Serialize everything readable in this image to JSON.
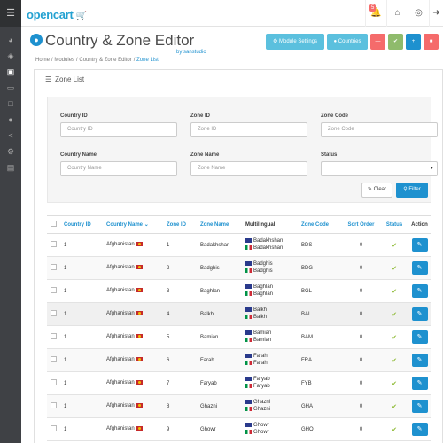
{
  "topbar": {
    "logo": "opencart",
    "logo_cart_icon": "cart-icon",
    "notification_count": "5"
  },
  "header": {
    "title": "Country & Zone Editor",
    "byline": "by sanstudio",
    "buttons": {
      "module_settings": "Module Settings",
      "countries": "Countries"
    },
    "colors": {
      "blue": "#5bc0de",
      "red": "#f56b6b",
      "green": "#8fbb6c",
      "primary": "#1e91cf"
    }
  },
  "breadcrumb": [
    "Home",
    "Modules",
    "Country & Zone Editor",
    "Zone List"
  ],
  "panel": {
    "heading": "Zone List"
  },
  "filter": {
    "country_id_label": "Country ID",
    "country_id_placeholder": "Country ID",
    "zone_id_label": "Zone ID",
    "zone_id_placeholder": "Zone ID",
    "zone_code_label": "Zone Code",
    "zone_code_placeholder": "Zone Code",
    "country_name_label": "Country Name",
    "country_name_placeholder": "Country Name",
    "zone_name_label": "Zone Name",
    "zone_name_placeholder": "Zone Name",
    "status_label": "Status",
    "status_value": "",
    "clear_label": "Clear",
    "filter_label": "Filter"
  },
  "table": {
    "columns": [
      "Country ID",
      "Country Name",
      "Zone ID",
      "Zone Name",
      "Multilingual",
      "Zone Code",
      "Sort Order",
      "Status",
      "Action"
    ],
    "rows": [
      {
        "country_id": "1",
        "country_name": "Afghanistan",
        "zone_id": "1",
        "zone_name": "Badakhshan",
        "ml_en": "Badakhshan",
        "ml_it": "Badakhshan",
        "code": "BDS",
        "sort": "0"
      },
      {
        "country_id": "1",
        "country_name": "Afghanistan",
        "zone_id": "2",
        "zone_name": "Badghis",
        "ml_en": "Badghis",
        "ml_it": "Badghis",
        "code": "BDG",
        "sort": "0"
      },
      {
        "country_id": "1",
        "country_name": "Afghanistan",
        "zone_id": "3",
        "zone_name": "Baghlan",
        "ml_en": "Baghlan",
        "ml_it": "Baghlan",
        "code": "BGL",
        "sort": "0"
      },
      {
        "country_id": "1",
        "country_name": "Afghanistan",
        "zone_id": "4",
        "zone_name": "Balkh",
        "ml_en": "Balkh",
        "ml_it": "Balkh",
        "code": "BAL",
        "sort": "0"
      },
      {
        "country_id": "1",
        "country_name": "Afghanistan",
        "zone_id": "5",
        "zone_name": "Bamian",
        "ml_en": "Bamian",
        "ml_it": "Bamian",
        "code": "BAM",
        "sort": "0"
      },
      {
        "country_id": "1",
        "country_name": "Afghanistan",
        "zone_id": "6",
        "zone_name": "Farah",
        "ml_en": "Farah",
        "ml_it": "Farah",
        "code": "FRA",
        "sort": "0"
      },
      {
        "country_id": "1",
        "country_name": "Afghanistan",
        "zone_id": "7",
        "zone_name": "Faryab",
        "ml_en": "Faryab",
        "ml_it": "Faryab",
        "code": "FYB",
        "sort": "0"
      },
      {
        "country_id": "1",
        "country_name": "Afghanistan",
        "zone_id": "8",
        "zone_name": "Ghazni",
        "ml_en": "Ghazni",
        "ml_it": "Ghazni",
        "code": "GHA",
        "sort": "0"
      },
      {
        "country_id": "1",
        "country_name": "Afghanistan",
        "zone_id": "9",
        "zone_name": "Ghowr",
        "ml_en": "Ghowr",
        "ml_it": "Ghowr",
        "code": "GHO",
        "sort": "0"
      }
    ]
  }
}
